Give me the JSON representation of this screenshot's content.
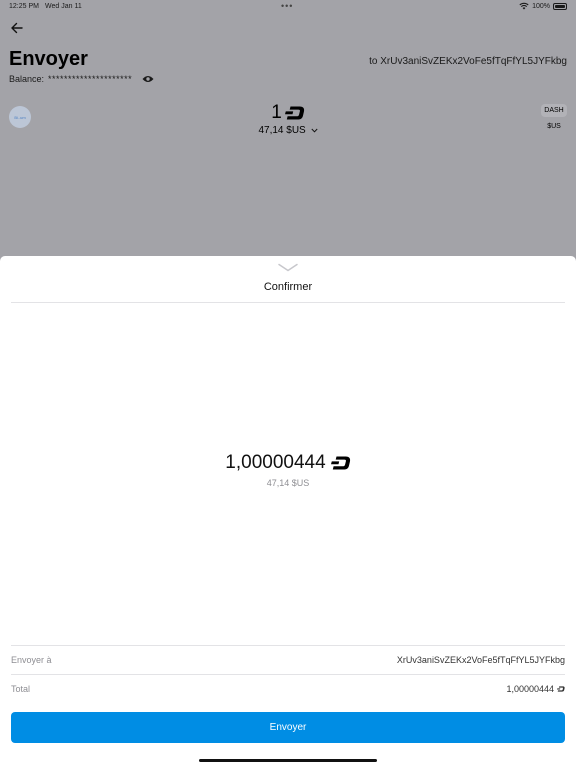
{
  "status_bar": {
    "time": "12:25 PM",
    "date": "Wed Jan 11",
    "dots": "•••",
    "battery": "100%"
  },
  "header": {
    "title": "Envoyer",
    "to_address": "to XrUv3aniSvZEKx2VoFe5fTqFfYL5JYFkbg",
    "balance_label": "Balance:",
    "balance_mask": "*********************"
  },
  "amount_entry": {
    "avatar_text": "Bi..um",
    "amount": "1",
    "fiat": "47,14 $US",
    "currency_primary": "DASH",
    "currency_secondary": "$US"
  },
  "sheet": {
    "title": "Confirmer",
    "amount": "1,00000444",
    "fiat": "47,14 $US",
    "rows": [
      {
        "label": "Envoyer à",
        "value": "XrUv3aniSvZEKx2VoFe5fTqFfYL5JYFkbg"
      },
      {
        "label": "Total",
        "value": "1,00000444",
        "icon": "dash-small-icon"
      }
    ],
    "send_label": "Envoyer"
  },
  "icons": {
    "back": "arrow-left-icon",
    "visibility": "eye-icon",
    "dash": "dash-logo-icon",
    "expand": "chevron-down-icon",
    "dismiss": "sheet-chevron-icon"
  },
  "colors": {
    "accent": "#008de4",
    "overlay": "#a3a3a8",
    "muted_text": "#8e8e93"
  }
}
